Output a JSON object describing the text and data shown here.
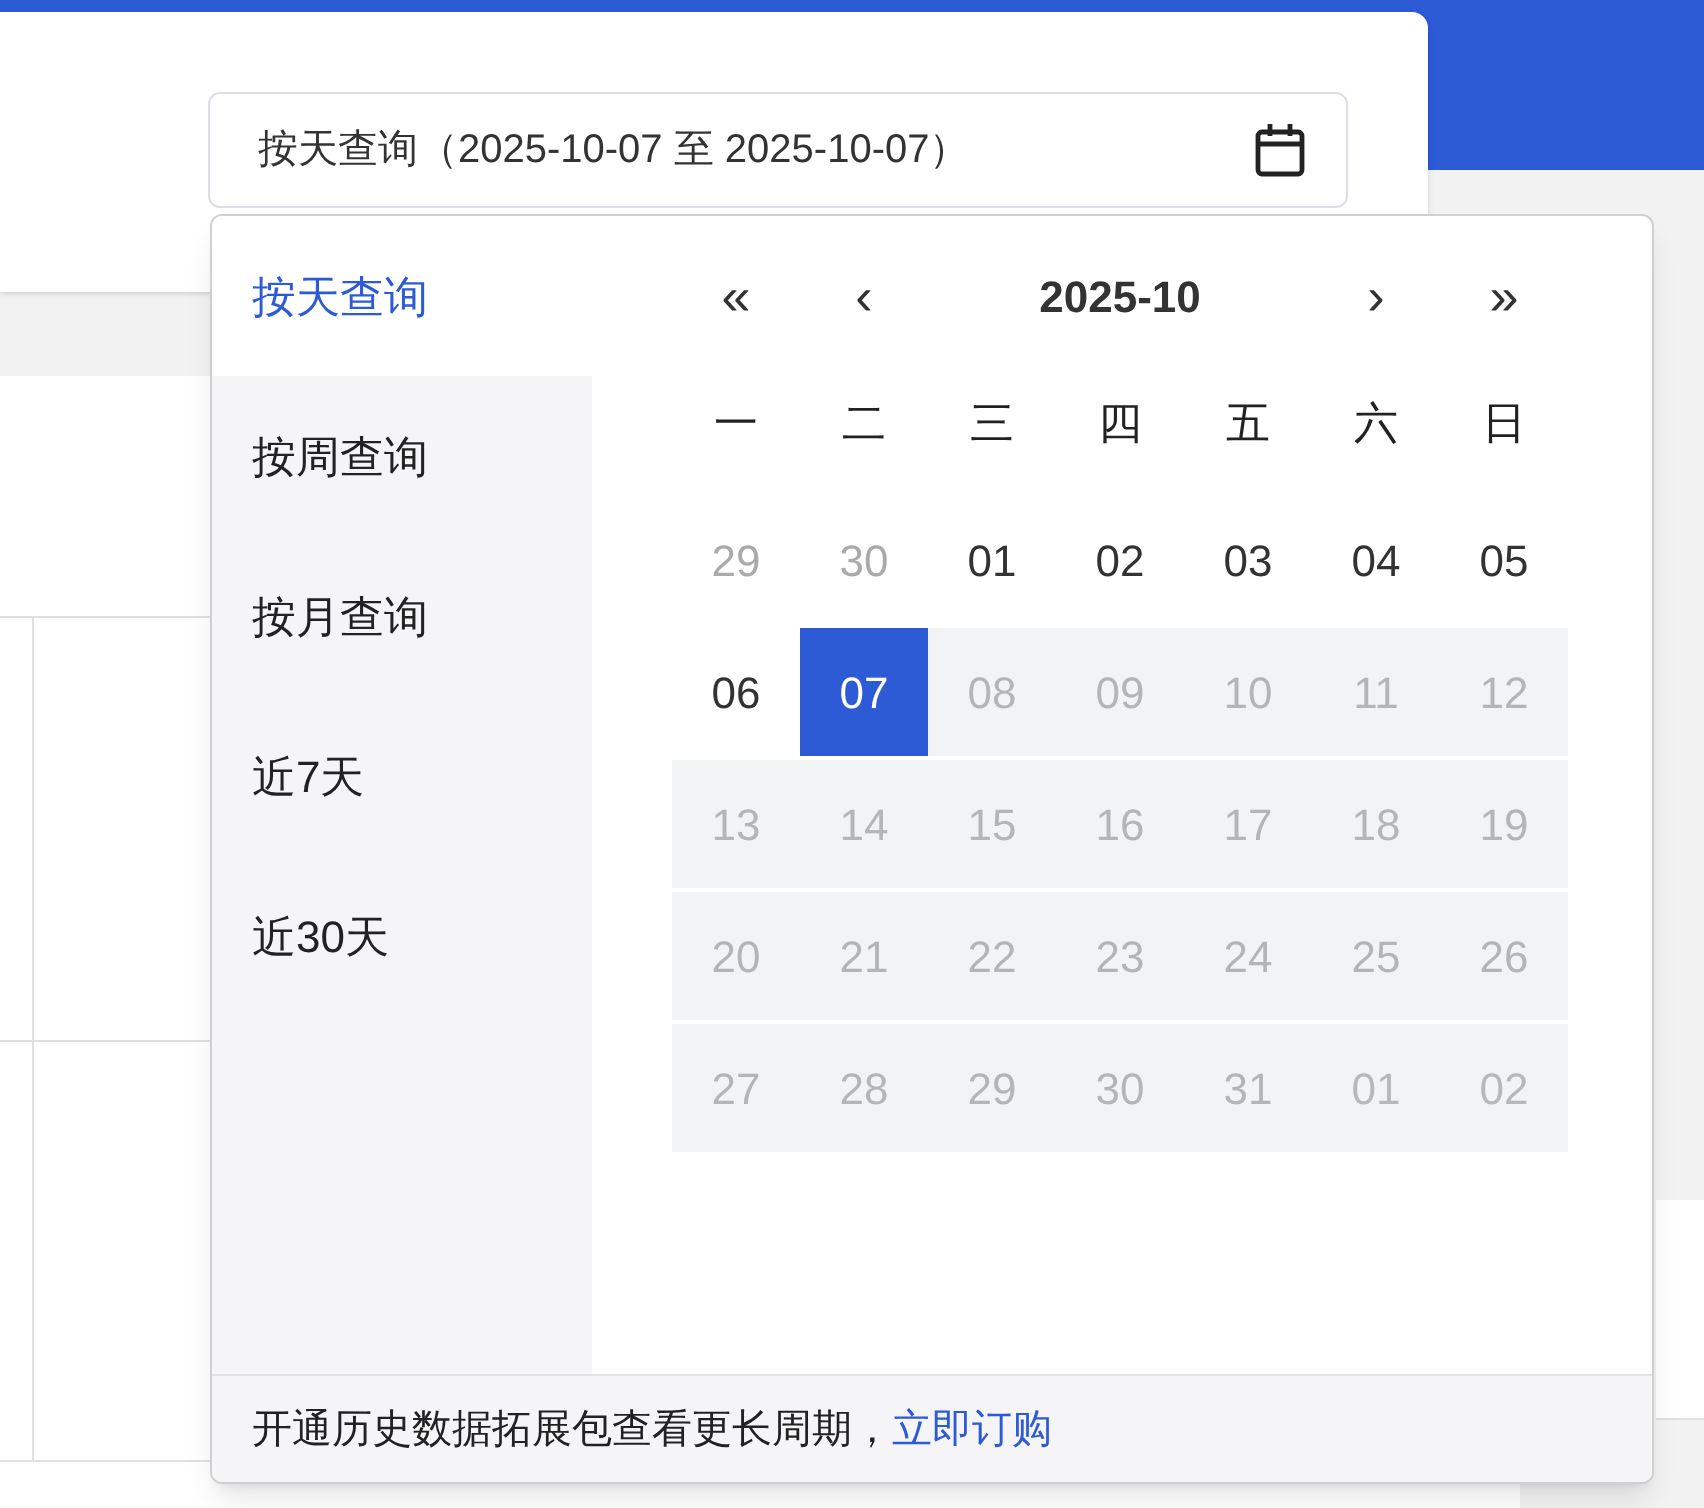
{
  "date_field": {
    "value": "按天查询（2025-10-07 至 2025-10-07）"
  },
  "modes": [
    {
      "label": "按天查询",
      "selected": true
    },
    {
      "label": "按周查询",
      "selected": false
    },
    {
      "label": "按月查询",
      "selected": false
    },
    {
      "label": "近7天",
      "selected": false
    },
    {
      "label": "近30天",
      "selected": false
    }
  ],
  "calendar": {
    "nav": [
      "«",
      "‹",
      "›",
      "»"
    ],
    "month": "2025-10",
    "weekdays": [
      "一",
      "二",
      "三",
      "四",
      "五",
      "六",
      "日"
    ],
    "days": [
      {
        "label": "29",
        "outside": true,
        "disabled": false,
        "selected": false
      },
      {
        "label": "30",
        "outside": true,
        "disabled": false,
        "selected": false
      },
      {
        "label": "01",
        "outside": false,
        "disabled": false,
        "selected": false
      },
      {
        "label": "02",
        "outside": false,
        "disabled": false,
        "selected": false
      },
      {
        "label": "03",
        "outside": false,
        "disabled": false,
        "selected": false
      },
      {
        "label": "04",
        "outside": false,
        "disabled": false,
        "selected": false
      },
      {
        "label": "05",
        "outside": false,
        "disabled": false,
        "selected": false
      },
      {
        "label": "06",
        "outside": false,
        "disabled": false,
        "selected": false
      },
      {
        "label": "07",
        "outside": false,
        "disabled": false,
        "selected": true
      },
      {
        "label": "08",
        "outside": false,
        "disabled": true,
        "selected": false
      },
      {
        "label": "09",
        "outside": false,
        "disabled": true,
        "selected": false
      },
      {
        "label": "10",
        "outside": false,
        "disabled": true,
        "selected": false
      },
      {
        "label": "11",
        "outside": false,
        "disabled": true,
        "selected": false
      },
      {
        "label": "12",
        "outside": false,
        "disabled": true,
        "selected": false
      },
      {
        "label": "13",
        "outside": false,
        "disabled": true,
        "selected": false
      },
      {
        "label": "14",
        "outside": false,
        "disabled": true,
        "selected": false
      },
      {
        "label": "15",
        "outside": false,
        "disabled": true,
        "selected": false
      },
      {
        "label": "16",
        "outside": false,
        "disabled": true,
        "selected": false
      },
      {
        "label": "17",
        "outside": false,
        "disabled": true,
        "selected": false
      },
      {
        "label": "18",
        "outside": false,
        "disabled": true,
        "selected": false
      },
      {
        "label": "19",
        "outside": false,
        "disabled": true,
        "selected": false
      },
      {
        "label": "20",
        "outside": false,
        "disabled": true,
        "selected": false
      },
      {
        "label": "21",
        "outside": false,
        "disabled": true,
        "selected": false
      },
      {
        "label": "22",
        "outside": false,
        "disabled": true,
        "selected": false
      },
      {
        "label": "23",
        "outside": false,
        "disabled": true,
        "selected": false
      },
      {
        "label": "24",
        "outside": false,
        "disabled": true,
        "selected": false
      },
      {
        "label": "25",
        "outside": false,
        "disabled": true,
        "selected": false
      },
      {
        "label": "26",
        "outside": false,
        "disabled": true,
        "selected": false
      },
      {
        "label": "27",
        "outside": false,
        "disabled": true,
        "selected": false
      },
      {
        "label": "28",
        "outside": false,
        "disabled": true,
        "selected": false
      },
      {
        "label": "29",
        "outside": false,
        "disabled": true,
        "selected": false
      },
      {
        "label": "30",
        "outside": false,
        "disabled": true,
        "selected": false
      },
      {
        "label": "31",
        "outside": false,
        "disabled": true,
        "selected": false
      },
      {
        "label": "01",
        "outside": true,
        "disabled": true,
        "selected": false
      },
      {
        "label": "02",
        "outside": true,
        "disabled": true,
        "selected": false
      }
    ]
  },
  "footer": {
    "text": "开通历史数据拓展包查看更长周期，",
    "link": "立即订购"
  }
}
